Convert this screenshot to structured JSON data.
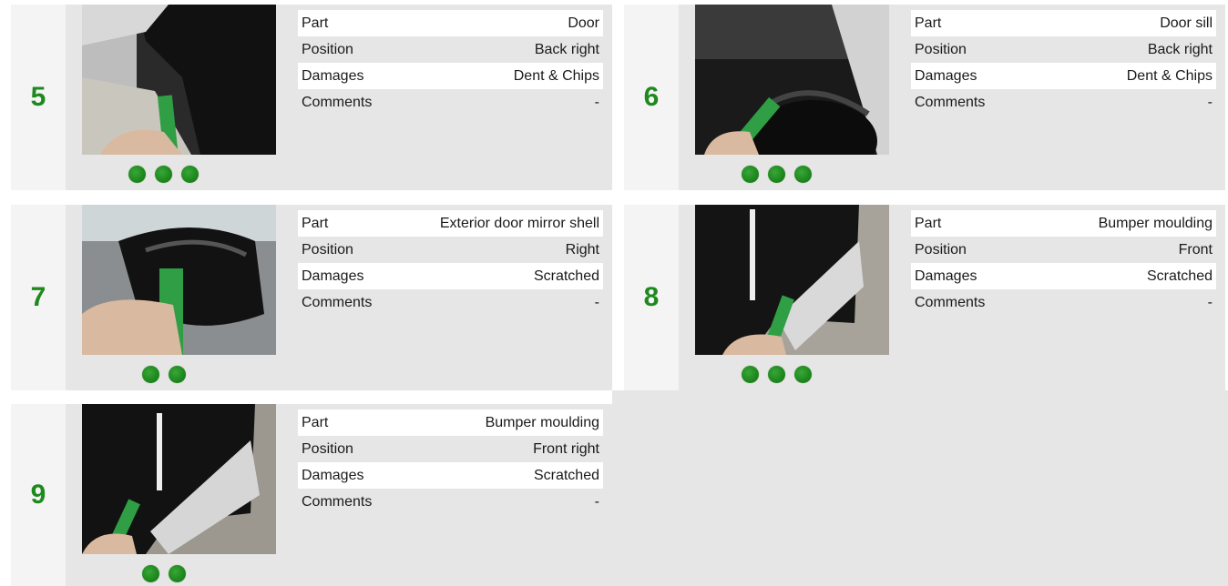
{
  "labels": {
    "part": "Part",
    "position": "Position",
    "damages": "Damages",
    "comments": "Comments"
  },
  "colors": {
    "accent_green": "#1e8a1e",
    "number_column": "#f4f4f4",
    "card_body": "#e6e6e6",
    "row_highlight": "#ffffff"
  },
  "damages": [
    {
      "number": "5",
      "part": "Door",
      "position": "Back right",
      "damages": "Dent & Chips",
      "comments": "-",
      "photo_count": 3
    },
    {
      "number": "6",
      "part": "Door sill",
      "position": "Back right",
      "damages": "Dent & Chips",
      "comments": "-",
      "photo_count": 3
    },
    {
      "number": "7",
      "part": "Exterior door mirror shell",
      "position": "Right",
      "damages": "Scratched",
      "comments": "-",
      "photo_count": 2
    },
    {
      "number": "8",
      "part": "Bumper moulding",
      "position": "Front",
      "damages": "Scratched",
      "comments": "-",
      "photo_count": 3
    },
    {
      "number": "9",
      "part": "Bumper moulding",
      "position": "Front right",
      "damages": "Scratched",
      "comments": "-",
      "photo_count": 2
    }
  ]
}
